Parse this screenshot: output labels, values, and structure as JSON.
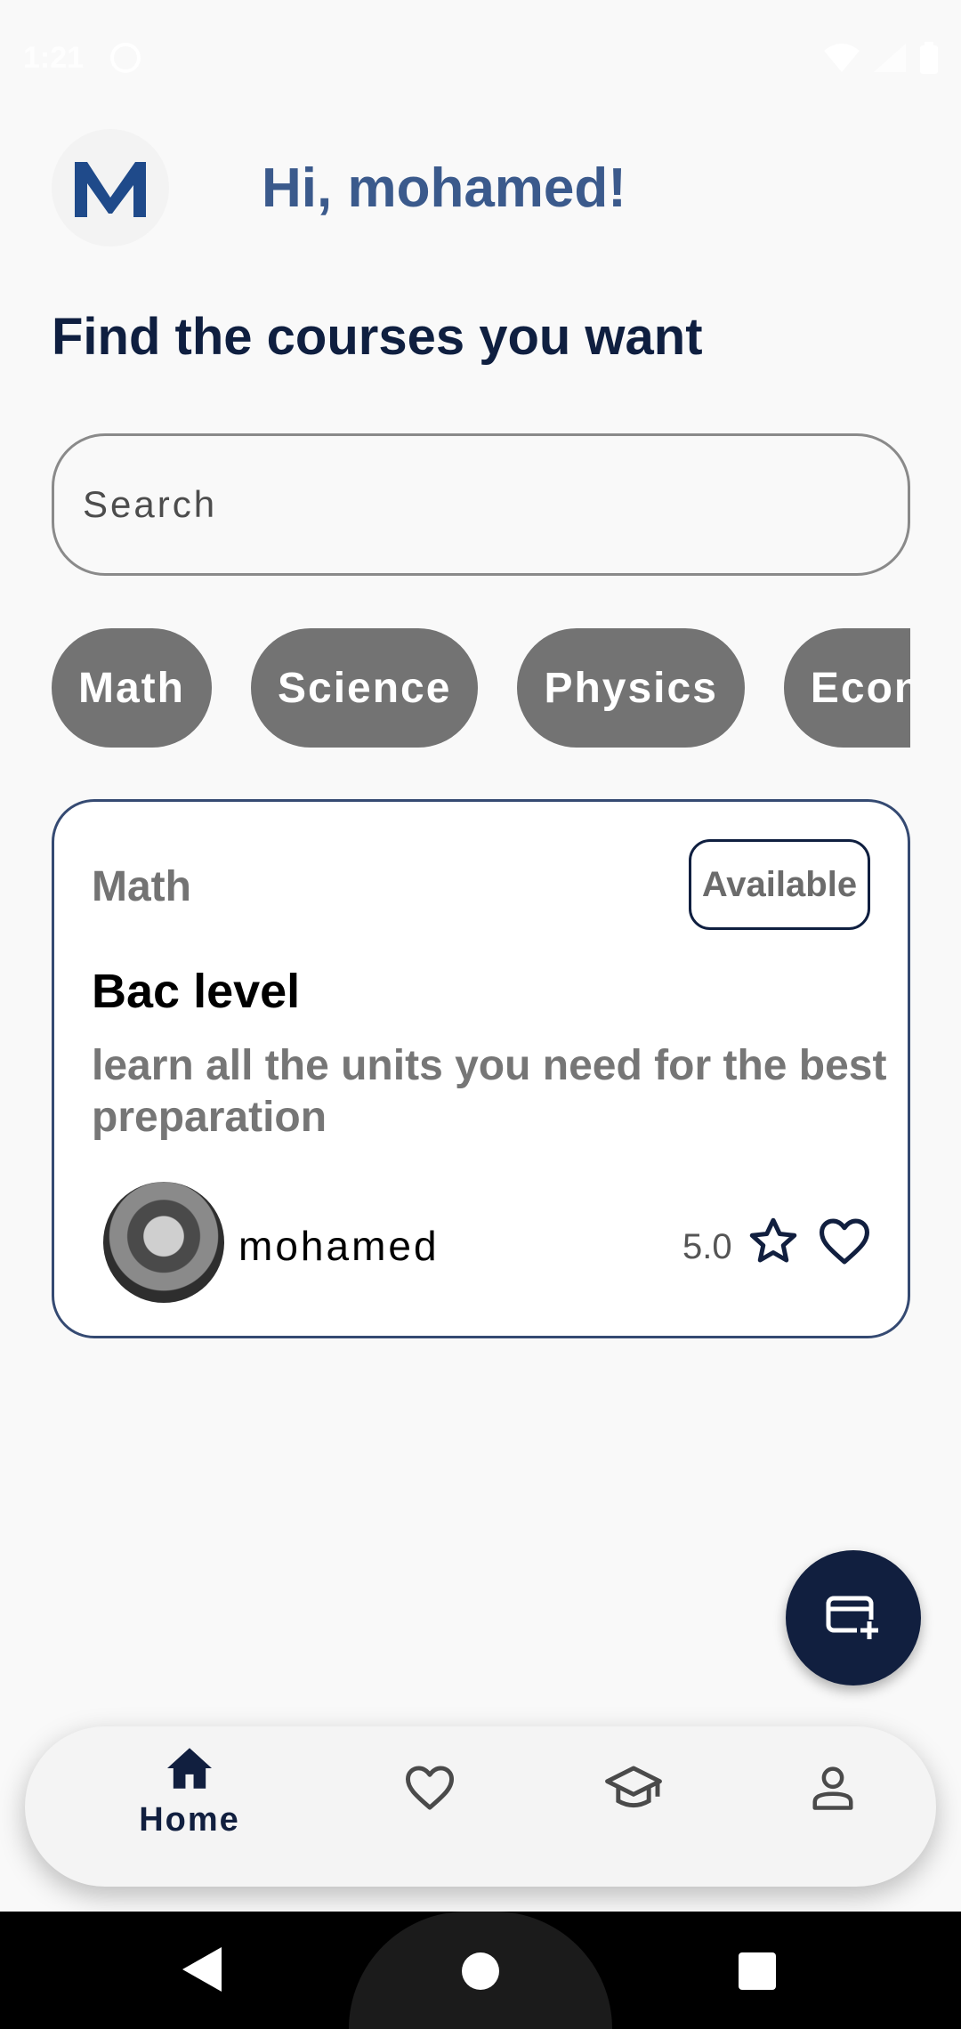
{
  "status_bar": {
    "time": "1:21"
  },
  "header": {
    "greeting": "Hi, mohamed!",
    "logo_letter": "M"
  },
  "subtitle": "Find the courses you want",
  "search": {
    "placeholder": "Search"
  },
  "chips": [
    "Math",
    "Science",
    "Physics",
    "Economics"
  ],
  "course_card": {
    "category": "Math",
    "status": "Available",
    "title": "Bac level",
    "description": "learn all the units you need for the best preparation",
    "author": "mohamed",
    "rating": "5.0"
  },
  "bottom_nav": {
    "home_label": "Home",
    "items": [
      "home-icon",
      "heart-icon",
      "graduation-cap-icon",
      "person-icon"
    ]
  },
  "colors": {
    "primary": "#111f3f",
    "greeting": "#3b5a8c",
    "chip_bg": "#737373",
    "background": "#f9f9f9"
  }
}
